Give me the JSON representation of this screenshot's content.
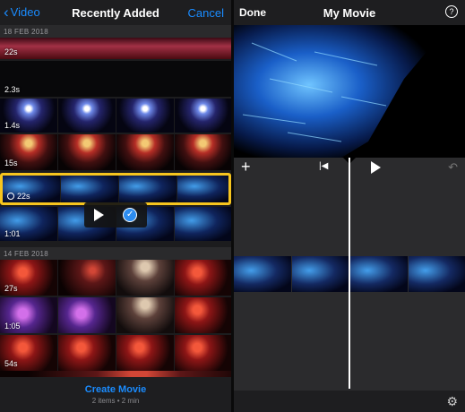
{
  "left": {
    "nav": {
      "back_label": "Video",
      "title": "Recently Added",
      "cancel_label": "Cancel"
    },
    "sections": [
      {
        "date": "18 FEB 2018"
      },
      {
        "date": "14 FEB 2018"
      }
    ],
    "clips": [
      {
        "duration": "22s",
        "thumbs": "blue"
      },
      {
        "duration": "2.3s",
        "thumbs": "dark"
      },
      {
        "duration": "1.4s",
        "thumbs": "stage-blue"
      },
      {
        "duration": "15s",
        "thumbs": "stage-red"
      },
      {
        "duration": "22s",
        "thumbs": "blue",
        "selected": true
      },
      {
        "duration": "1:01",
        "thumbs": "blue"
      },
      {
        "duration": "27s",
        "thumbs": "concert-red"
      },
      {
        "duration": "1:05",
        "thumbs": "concert-purple"
      },
      {
        "duration": "54s",
        "thumbs": "concert-red"
      }
    ],
    "footer": {
      "create_label": "Create Movie",
      "meta": "2 items • 2 min"
    }
  },
  "right": {
    "nav": {
      "done_label": "Done",
      "title": "My Movie",
      "help_label": "?"
    }
  },
  "colors": {
    "accent": "#1a8cff",
    "selection": "#f7c51e",
    "check": "#2c8cf0"
  },
  "icons": [
    "chevron-left-icon",
    "play-icon",
    "checkmark-icon",
    "plus-icon",
    "skip-back-icon",
    "undo-icon",
    "gear-icon",
    "help-icon"
  ]
}
